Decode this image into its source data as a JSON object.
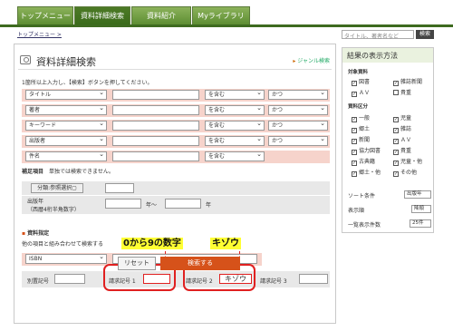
{
  "nav": {
    "tabs": [
      "トップメニュー",
      "資料詳細検索",
      "資料紹介",
      "Myライブラリ"
    ],
    "active_index": 1
  },
  "breadcrumb": "トップメニュー >",
  "global_search": {
    "placeholder": "タイトル、著者名など",
    "button": "検索"
  },
  "main": {
    "title": "資料詳細検索",
    "genre_link": "ジャンル検索",
    "intro": "1箇所以上入力し、【検索】ボタンを押してください。",
    "rows": [
      {
        "field": "タイトル",
        "match": "を含む",
        "op": "かつ"
      },
      {
        "field": "著者",
        "match": "を含む",
        "op": "かつ"
      },
      {
        "field": "キーワード",
        "match": "を含む",
        "op": "かつ"
      },
      {
        "field": "出版者",
        "match": "を含む",
        "op": "かつ"
      },
      {
        "field": "件名",
        "match": "を含む",
        "op": ""
      }
    ],
    "supplement_label": "補足項目",
    "supplement_note": "単独では検索できません。",
    "category_button": "分類:参照選択▢",
    "year_label": "出版年",
    "year_sub": "（西暦4桁半角数字）",
    "year_from_suffix": "年～",
    "year_to_suffix": "年",
    "shiryo_label": "資料指定",
    "shiryo_note": "他の項目と組み合わせて検索する",
    "isbn": "ISBN",
    "row_labels": [
      "別置記号",
      "請求記号 1",
      "請求記号 2",
      "請求記号 3"
    ],
    "seikyu2_value": "キゾウ",
    "callout_left": "0から9の数字",
    "callout_right": "キゾウ",
    "reset": "リセット",
    "search": "検索する"
  },
  "side": {
    "title": "結果の表示方法",
    "shiryo_label": "対象資料",
    "shiryo": [
      {
        "label": "図書",
        "checked": true
      },
      {
        "label": "雑誌新聞",
        "checked": true
      },
      {
        "label": "ＡＶ",
        "checked": true
      },
      {
        "label": "貴重",
        "checked": false
      }
    ],
    "kubun_label": "資料区分",
    "kubun": [
      {
        "label": "一般",
        "checked": true
      },
      {
        "label": "児童",
        "checked": true
      },
      {
        "label": "郷土",
        "checked": true
      },
      {
        "label": "雑誌",
        "checked": true
      },
      {
        "label": "新聞",
        "checked": true
      },
      {
        "label": "ＡＶ",
        "checked": true
      },
      {
        "label": "協力図書",
        "checked": true
      },
      {
        "label": "貴重",
        "checked": true
      },
      {
        "label": "古典籍",
        "checked": true
      },
      {
        "label": "児童・他",
        "checked": true
      },
      {
        "label": "郷土・他",
        "checked": true
      },
      {
        "label": "その他",
        "checked": true
      }
    ],
    "sort_label": "ソート条件",
    "sort_value": "出版年",
    "display_label": "表示順",
    "display_value": "降順",
    "count_label": "一覧表示件数",
    "count_value": "25件"
  }
}
